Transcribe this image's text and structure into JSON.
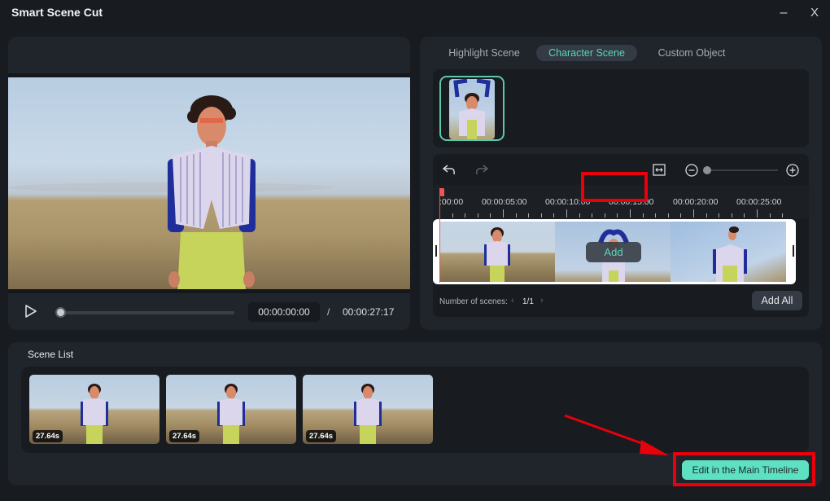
{
  "window": {
    "title": "Smart Scene Cut",
    "minimize_glyph": "–",
    "close_glyph": "X"
  },
  "player": {
    "current_time": "00:00:00:00",
    "separator": "/",
    "total_time": "00:00:27:17",
    "progress_fraction": 0.0
  },
  "tabs": [
    {
      "label": "Highlight Scene",
      "active": false
    },
    {
      "label": "Character Scene",
      "active": true
    },
    {
      "label": "Custom Object",
      "active": false
    }
  ],
  "colors": {
    "accent": "#5ad6b7",
    "primary_button": "#5ee0c3",
    "annotation_red": "#e8000b",
    "playhead": "#f05454",
    "panel": "#20252c",
    "background": "#181b1f"
  },
  "timeline": {
    "ruler_labels": [
      ":00:00",
      "00:00:05:00",
      "00:00:10:00",
      "00:00:15:00",
      "00:00:20:00",
      "00:00:25:00"
    ],
    "zoom_level_fraction": 0.0,
    "add_label": "Add",
    "scenes_label": "Number of scenes:",
    "scenes_value": "1/1",
    "prev_glyph": "‹",
    "next_glyph": "›",
    "add_all_label": "Add All"
  },
  "scene_list": {
    "title": "Scene List",
    "scenes": [
      {
        "duration": "27.64s"
      },
      {
        "duration": "27.64s"
      },
      {
        "duration": "27.64s"
      }
    ]
  },
  "footer": {
    "edit_label": "Edit in the Main Timeline"
  }
}
